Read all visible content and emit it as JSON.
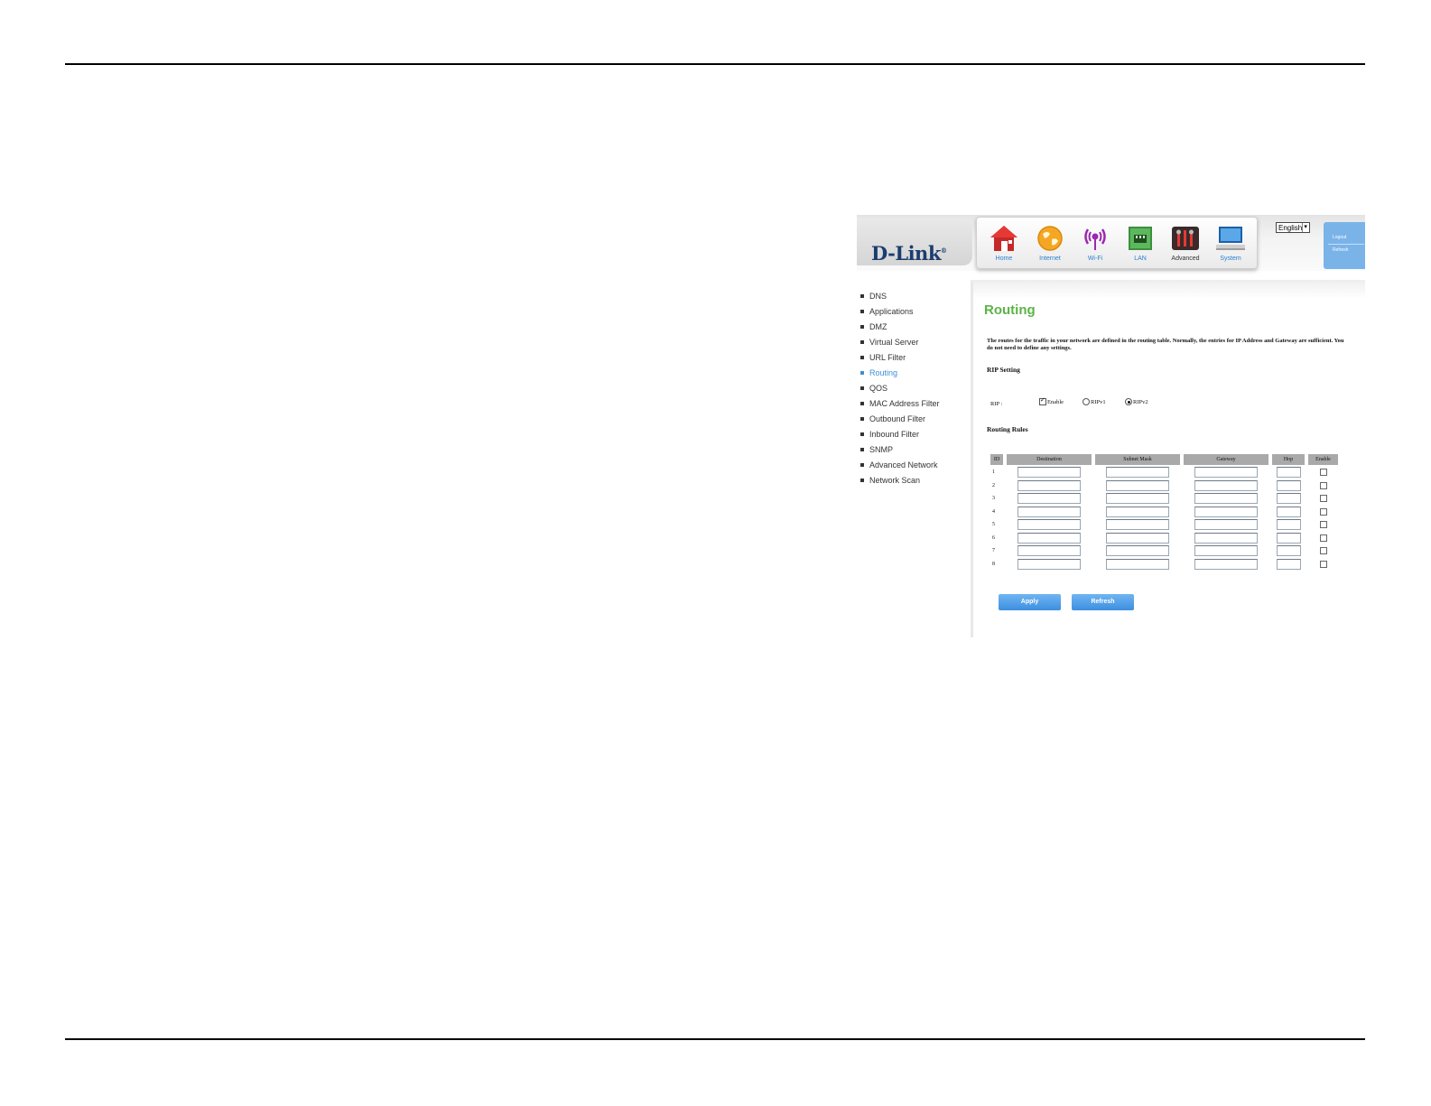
{
  "router": {
    "logo": {
      "brand": "D-Link",
      "mark": "®"
    },
    "nav": [
      {
        "label": "Home",
        "icon": "house-icon"
      },
      {
        "label": "Internet",
        "icon": "globe-icon"
      },
      {
        "label": "Wi-Fi",
        "icon": "wifi-antenna-icon"
      },
      {
        "label": "LAN",
        "icon": "lan-port-icon"
      },
      {
        "label": "Advanced",
        "icon": "tools-icon"
      },
      {
        "label": "System",
        "icon": "monitor-icon"
      }
    ],
    "language": {
      "selected": "English"
    },
    "side_links": {
      "logout": "Logout",
      "refresh": "Refresh"
    },
    "menu": [
      {
        "label": "DNS",
        "active": false
      },
      {
        "label": "Applications",
        "active": false
      },
      {
        "label": "DMZ",
        "active": false
      },
      {
        "label": "Virtual Server",
        "active": false
      },
      {
        "label": "URL Filter",
        "active": false
      },
      {
        "label": "Routing",
        "active": true
      },
      {
        "label": "QOS",
        "active": false
      },
      {
        "label": "MAC Address Filter",
        "active": false
      },
      {
        "label": "Outbound Filter",
        "active": false
      },
      {
        "label": "Inbound Filter",
        "active": false
      },
      {
        "label": "SNMP",
        "active": false
      },
      {
        "label": "Advanced Network",
        "active": false
      },
      {
        "label": "Network Scan",
        "active": false
      }
    ],
    "page": {
      "title": "Routing",
      "description": "The routes for the traffic in your network are defined in the routing table. Normally, the entries for IP Address and Gateway are sufficient. You do not need to define any settings.",
      "rip_section": "RIP Setting",
      "rip_label": "RIP :",
      "rip_enable_label": "Enable",
      "rip_enable_checked": true,
      "rip_v1_label": "RIPv1",
      "rip_v2_label": "RIPv2",
      "rip_version_selected": "RIPv2",
      "rules_section": "Routing Rules",
      "columns": [
        "ID",
        "Destination",
        "Subnet Mask",
        "Gateway",
        "Hop",
        "Enable"
      ],
      "row_ids": [
        "1",
        "2",
        "3",
        "4",
        "5",
        "6",
        "7",
        "8"
      ],
      "apply_label": "Apply",
      "refresh_label": "Refresh"
    },
    "colors": {
      "title_green": "#5cb347",
      "accent_blue": "#3d8fd6",
      "logo_navy": "#1b3d6e"
    }
  }
}
